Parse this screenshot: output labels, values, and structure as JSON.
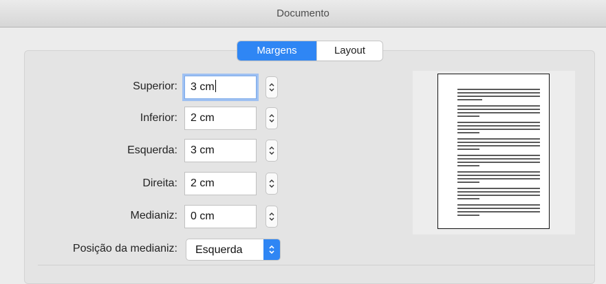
{
  "window": {
    "title": "Documento"
  },
  "tabs": [
    {
      "label": "Margens",
      "active": true
    },
    {
      "label": "Layout",
      "active": false
    }
  ],
  "margins": {
    "superior": {
      "label": "Superior:",
      "value": "3 cm"
    },
    "inferior": {
      "label": "Inferior:",
      "value": "2 cm"
    },
    "esquerda": {
      "label": "Esquerda:",
      "value": "3 cm"
    },
    "direita": {
      "label": "Direita:",
      "value": "2 cm"
    },
    "medianiz": {
      "label": "Medianiz:",
      "value": "0 cm"
    }
  },
  "gutter_position": {
    "label": "Posição da medianiz:",
    "value": "Esquerda"
  },
  "colors": {
    "accent": "#2f86f4",
    "focus_ring": "#9fc1f2"
  },
  "icons": {
    "stepper": "stepper-arrows-icon",
    "popup": "popup-chevrons-icon"
  }
}
